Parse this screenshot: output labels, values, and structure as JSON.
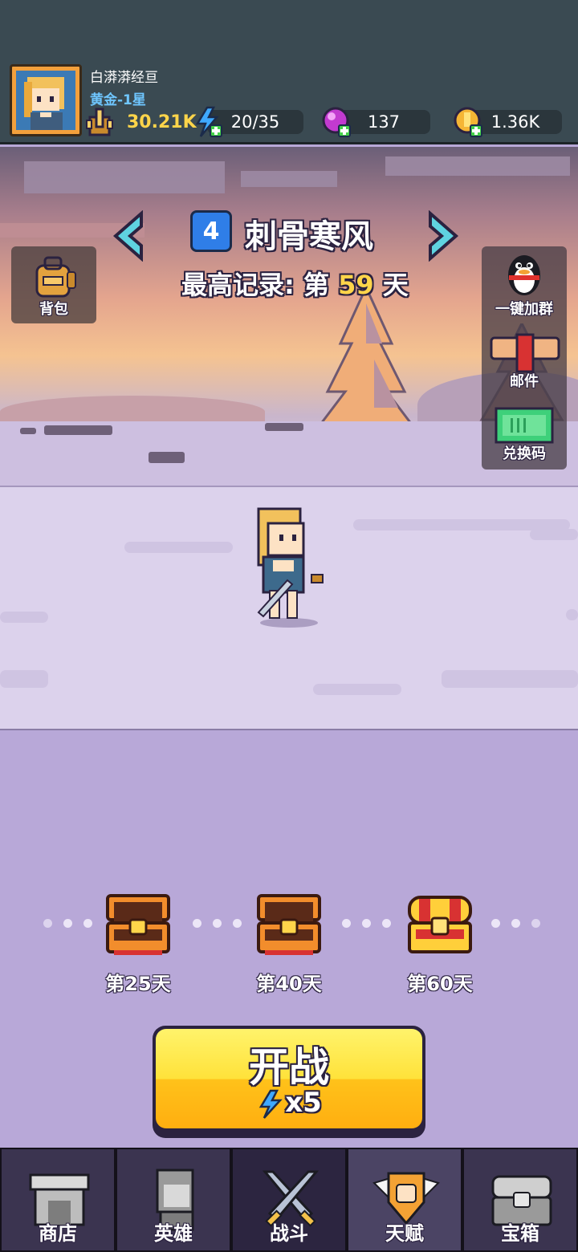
{
  "player": {
    "name": "白漭漭经亘",
    "rank": "黄金-1星",
    "power": "30.21K"
  },
  "resources": {
    "energy": "20/35",
    "gems": "137",
    "gold": "1.36K"
  },
  "level": {
    "number": "4",
    "title": "刺骨寒风",
    "record_prefix": "最高记录: 第",
    "record_value": "59",
    "record_suffix": "天"
  },
  "side_buttons": {
    "bag": "背包",
    "join_group": "一键加群",
    "mail": "邮件",
    "redeem": "兑换码"
  },
  "milestones": [
    {
      "label": "第25天"
    },
    {
      "label": "第40天"
    },
    {
      "label": "第60天"
    }
  ],
  "start_button": {
    "label": "开战",
    "cost": "x5"
  },
  "nav": {
    "shop": "商店",
    "heroes": "英雄",
    "battle": "战斗",
    "talent": "天赋",
    "chest": "宝箱"
  },
  "colors": {
    "accent_yellow": "#ffd54a",
    "rank_blue": "#6fc6ff",
    "level_badge": "#2f7ee8"
  }
}
